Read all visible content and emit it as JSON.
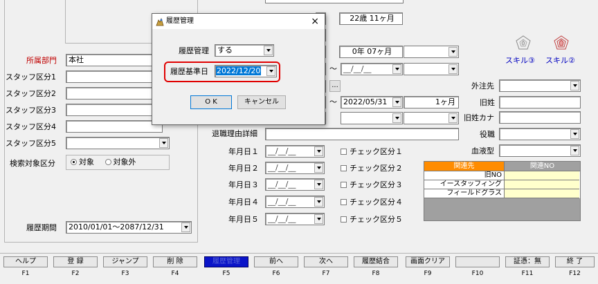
{
  "left": {
    "labels": {
      "department": "所属部門",
      "staff1": "スタッフ区分1",
      "staff2": "スタッフ区分2",
      "staff3": "スタッフ区分3",
      "staff4": "スタッフ区分4",
      "staff5": "スタッフ区分5",
      "search_target": "検索対象区分",
      "period": "履歴期間"
    },
    "department_value": "本社",
    "radio_target": "対象",
    "radio_excluded": "対象外",
    "period_value": "2010/01/01〜2087/12/31"
  },
  "middle": {
    "age": "22歳 11ヶ月",
    "tenure": "0年 07ヶ月",
    "tilde": "〜",
    "date_blank": "__/__/__",
    "ellipsis": "...",
    "end_date": "2022/05/31",
    "months": "1ヶ月",
    "resign_detail_label": "退職理由詳細",
    "date_rows": [
      {
        "label": "年月日１",
        "value": "__/__/__",
        "check": "チェック区分１"
      },
      {
        "label": "年月日２",
        "value": "__/__/__",
        "check": "チェック区分２"
      },
      {
        "label": "年月日３",
        "value": "__/__/__",
        "check": "チェック区分３"
      },
      {
        "label": "年月日４",
        "value": "__/__/__",
        "check": "チェック区分４"
      },
      {
        "label": "年月日５",
        "value": "__/__/__",
        "check": "チェック区分５"
      }
    ]
  },
  "right": {
    "skill3": "スキル③",
    "skill2": "スキル②",
    "outsource": "外注先",
    "old_name": "旧姓",
    "old_name_kana": "旧姓カナ",
    "position": "役職",
    "blood": "血液型",
    "table_headers": [
      "関連先",
      "関連NO"
    ],
    "table_rows": [
      "旧NO",
      "イースタッフィング",
      "フィールドグラス"
    ]
  },
  "dialog": {
    "title": "履歴管理",
    "history_label": "履歴管理",
    "history_value": "する",
    "base_date_label": "履歴基準日",
    "base_date_value": "2022/12/20",
    "ok": "O K",
    "cancel": "キャンセル",
    "close": "×"
  },
  "fkeys": {
    "labels": [
      "ヘルプ",
      "登 録",
      "ジャンプ",
      "削 除",
      "履歴管理",
      "前へ",
      "次へ",
      "履歴結合",
      "画面クリア",
      "",
      "証憑：無",
      "終 了"
    ],
    "names": [
      "F1",
      "F2",
      "F3",
      "F4",
      "F5",
      "F6",
      "F7",
      "F8",
      "F9",
      "F10",
      "F11",
      "F12"
    ]
  },
  "colors": {
    "department_label": "#c00000",
    "highlight_ring": "#e00000",
    "selection": "#0078d7",
    "table_header": "#ff8c00",
    "table_header2": "#a0a0a0",
    "skill_icon": "#c04040",
    "active_fkey": "#0a14c8"
  }
}
